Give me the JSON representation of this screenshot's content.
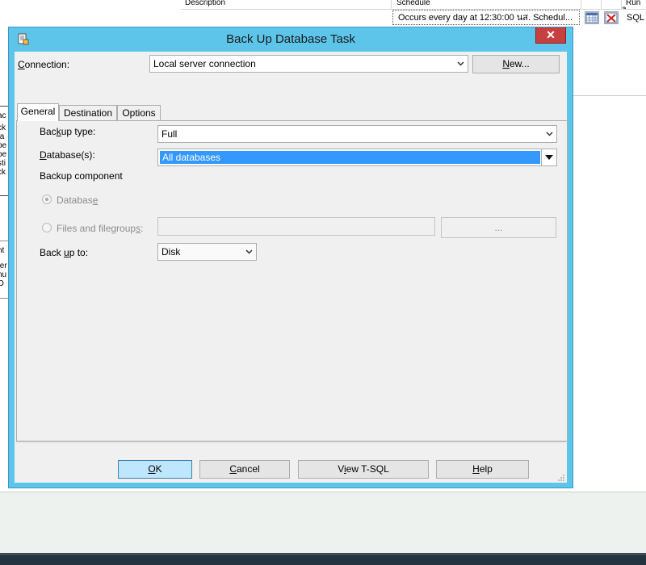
{
  "background": {
    "columns": {
      "description": "Description",
      "schedule": "Schedule",
      "run_as": "Run a"
    },
    "row": {
      "schedule_text": "Occurs every day at 12:30:00 นส. Schedul...",
      "run_as_value": "SQL"
    },
    "left_panel_fragments": [
      "ac",
      "ck",
      "ta",
      "pe",
      "pe",
      "sti",
      "ck"
    ],
    "left_panel2_fragments": [
      "nt",
      "",
      "ter",
      "nu",
      "O"
    ]
  },
  "dialog": {
    "title": "Back Up Database Task",
    "close_glyph": "✕",
    "connection": {
      "label_underlined": "C",
      "label_rest": "onnection:",
      "value": "Local server connection",
      "new_button_underlined": "N",
      "new_button_rest": "ew..."
    },
    "tabs": [
      {
        "label": "General",
        "active": true
      },
      {
        "label": "Destination",
        "active": false
      },
      {
        "label": "Options",
        "active": false
      }
    ],
    "general": {
      "backup_type": {
        "label_pre": "Bac",
        "label_underlined": "k",
        "label_post": "up type:",
        "value": "Full"
      },
      "databases": {
        "label_underlined": "D",
        "label_rest": "atabase(s):",
        "value": "All databases"
      },
      "backup_component": {
        "label": "Backup component"
      },
      "database_option": {
        "label_pre": "Databas",
        "label_underlined": "e",
        "label_post": "",
        "checked": true,
        "enabled": false
      },
      "files_option": {
        "label_pre": "Files and filegroup",
        "label_underlined": "s",
        "label_post": ":",
        "checked": false,
        "enabled": false
      },
      "browse_button": "...",
      "back_up_to": {
        "label_pre": "Back ",
        "label_underlined": "u",
        "label_post": "p to:",
        "value": "Disk"
      }
    },
    "buttons": {
      "ok": {
        "underlined": "O",
        "rest": "K"
      },
      "cancel": {
        "underlined": "C",
        "rest": "ancel"
      },
      "view_tsql": {
        "pre": "V",
        "underlined": "i",
        "rest": "ew T-SQL"
      },
      "help": {
        "underlined": "H",
        "rest": "elp"
      }
    }
  },
  "colors": {
    "title_bar": "#5ec5ea",
    "close_button": "#c74040",
    "selection": "#3399ff",
    "default_button": "#bee6fd"
  }
}
